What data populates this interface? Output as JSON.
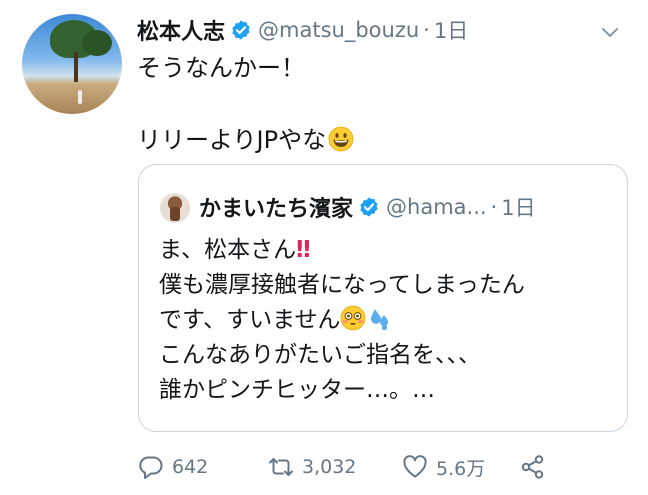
{
  "tweet": {
    "author_name": "松本人志",
    "handle": "@matsu_bouzu",
    "separator": "·",
    "time": "1日",
    "text_lines": [
      "そうなんかー！",
      "",
      "リリーよりJPやな"
    ],
    "icons": {
      "verified": "verified-badge-icon",
      "caret": "chevron-down-icon",
      "emoji": "grinning-face-emoji"
    }
  },
  "quoted_tweet": {
    "author_name": "かまいたち濱家",
    "handle": "@hama...",
    "separator": "·",
    "time": "1日",
    "line1_text": "ま、松本さん",
    "line1_mark": "‼",
    "line2": "僕も濃厚接触者になってしまったん",
    "line3_text": "です、すいません",
    "line4": "こんなありがたいご指名を、、、",
    "line5": "誰かピンチヒッター…。…",
    "icons": {
      "emoji_flushed": "flushed-face-emoji",
      "emoji_sweat": "sweat-droplets-emoji"
    }
  },
  "actions": {
    "reply_count": "642",
    "retweet_count": "3,032",
    "like_count": "5.6万",
    "icons": [
      "reply-icon",
      "retweet-icon",
      "like-icon",
      "share-icon"
    ]
  },
  "colors": {
    "text": "#14171a",
    "muted": "#657786",
    "verified": "#1da1f2",
    "border": "#ccd6dd"
  }
}
